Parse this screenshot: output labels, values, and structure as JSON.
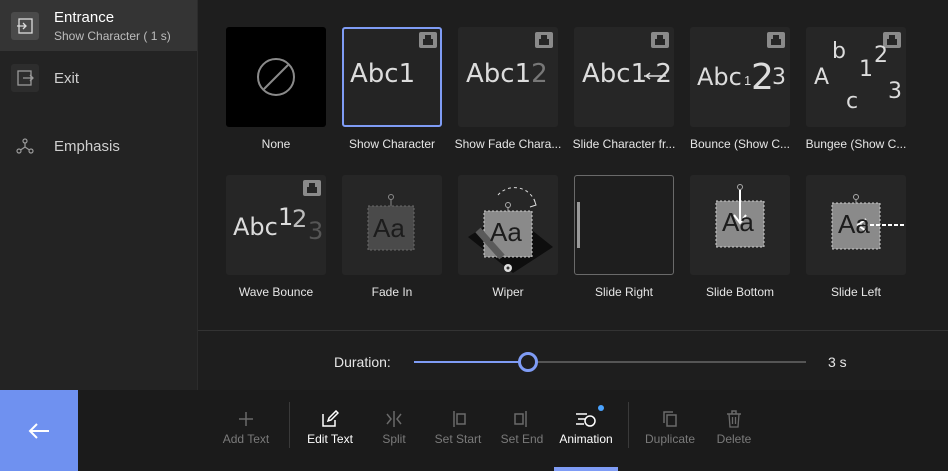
{
  "sidebar": {
    "items": [
      {
        "label": "Entrance",
        "sublabel": "Show Character ( 1 s)",
        "icon": "entrance-icon"
      },
      {
        "label": "Exit",
        "icon": "exit-icon"
      },
      {
        "label": "Emphasis",
        "icon": "emphasis-icon"
      }
    ]
  },
  "animations": [
    {
      "label": "None"
    },
    {
      "label": "Show Character",
      "preview": "Abc1"
    },
    {
      "label": "Show Fade Chara...",
      "preview_a": "Abc1",
      "preview_b": "2"
    },
    {
      "label": "Slide Character fr...",
      "preview_a": "Abc1",
      "preview_b": "2"
    },
    {
      "label": "Bounce (Show C...",
      "preview_a": "Abc",
      "preview_b": "1",
      "preview_c": "2",
      "preview_d": "3"
    },
    {
      "label": "Bungee (Show C...",
      "chars": [
        "A",
        "b",
        "c",
        "1",
        "2",
        "3"
      ]
    },
    {
      "label": "Wave Bounce",
      "preview_a": "Abc",
      "preview_b": "1",
      "preview_c": "2",
      "preview_d": "3"
    },
    {
      "label": "Fade In",
      "preview": "Aa"
    },
    {
      "label": "Wiper",
      "preview": "Aa"
    },
    {
      "label": "Slide Right"
    },
    {
      "label": "Slide Bottom",
      "preview": "Aa"
    },
    {
      "label": "Slide Left",
      "preview": "Aa"
    }
  ],
  "duration": {
    "label": "Duration:",
    "value": "3 s",
    "level": 0.29
  },
  "toolbar": {
    "back_icon": "arrow-left-icon",
    "tools": [
      {
        "label": "Add Text",
        "icon": "plus-icon"
      },
      {
        "label": "Edit Text",
        "icon": "edit-icon"
      },
      {
        "label": "Split",
        "icon": "split-icon"
      },
      {
        "label": "Set Start",
        "icon": "set-start-icon"
      },
      {
        "label": "Set End",
        "icon": "set-end-icon"
      },
      {
        "label": "Animation",
        "icon": "animation-icon"
      },
      {
        "label": "Duplicate",
        "icon": "duplicate-icon"
      },
      {
        "label": "Delete",
        "icon": "trash-icon"
      }
    ]
  },
  "colors": {
    "accent": "#7f9cf5",
    "back_button": "#6f91f0"
  }
}
